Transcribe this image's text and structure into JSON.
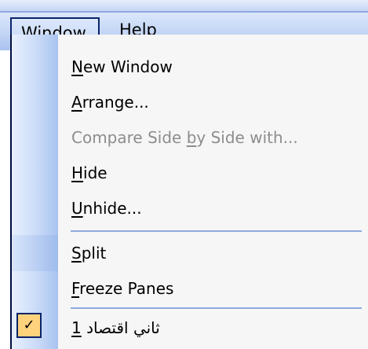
{
  "menubar": {
    "items": [
      {
        "pre": "",
        "ul": "W",
        "post": "indow"
      },
      {
        "pre": "",
        "ul": "H",
        "post": "elp"
      }
    ]
  },
  "window_menu": {
    "items": [
      {
        "pre": "",
        "ul": "N",
        "post": "ew Window",
        "disabled": false
      },
      {
        "pre": "",
        "ul": "A",
        "post": "rrange...",
        "disabled": false
      },
      {
        "pre": "Compare Side ",
        "ul": "b",
        "post": "y Side with...",
        "disabled": true
      },
      {
        "pre": "",
        "ul": "H",
        "post": "ide",
        "disabled": false
      },
      {
        "pre": "",
        "ul": "U",
        "post": "nhide...",
        "disabled": false
      },
      {
        "pre": "",
        "ul": "S",
        "post": "plit",
        "disabled": false
      },
      {
        "pre": "",
        "ul": "F",
        "post": "reeze Panes",
        "disabled": false
      },
      {
        "pre": "ثاني اقتصاد ",
        "ul": "1",
        "post": "",
        "disabled": false,
        "checked": true
      }
    ],
    "check_icon": "checkmark-icon"
  }
}
